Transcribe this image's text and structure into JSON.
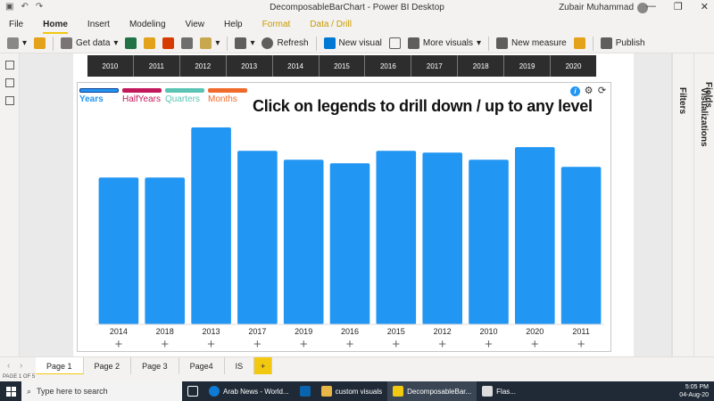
{
  "window": {
    "title": "DecomposableBarChart - Power BI Desktop",
    "user": "Zubair Muhammad",
    "minimize": "—",
    "maximize": "❐",
    "close": "✕"
  },
  "menu": [
    "File",
    "Home",
    "Insert",
    "Modeling",
    "View",
    "Help",
    "Format",
    "Data / Drill"
  ],
  "ribbon": {
    "get_data": "Get data",
    "refresh": "Refresh",
    "new_visual": "New visual",
    "more_visuals": "More visuals",
    "new_measure": "New measure",
    "publish": "Publish"
  },
  "panes": {
    "filters": "Filters",
    "visualizations": "Visualizations",
    "fields": "Fields"
  },
  "slicer_years": [
    "2010",
    "2011",
    "2012",
    "2013",
    "2014",
    "2015",
    "2016",
    "2017",
    "2018",
    "2019",
    "2020"
  ],
  "visual": {
    "headline": "Click on legends to drill down / up to any level",
    "legend": [
      {
        "label": "Years",
        "color": "#2196f3"
      },
      {
        "label": "HalfYears",
        "color": "#c2185b"
      },
      {
        "label": "Quarters",
        "color": "#5cc4b4"
      },
      {
        "label": "Months",
        "color": "#f06a2b"
      }
    ],
    "info_icon": "i"
  },
  "chart_data": {
    "type": "bar",
    "categories": [
      "2014",
      "2018",
      "2013",
      "2017",
      "2019",
      "2016",
      "2015",
      "2012",
      "2010",
      "2020",
      "2011"
    ],
    "values": [
      164,
      164,
      220,
      194,
      184,
      180,
      194,
      192,
      184,
      198,
      176
    ],
    "ylim": [
      0,
      230
    ],
    "bar_color": "#2196f3",
    "expand_symbol": "+"
  },
  "pages": [
    "Page 1",
    "Page 2",
    "Page 3",
    "Page4",
    "IS",
    "+"
  ],
  "status": "PAGE 1 OF 5",
  "taskbar": {
    "search_placeholder": "Type here to search",
    "apps": [
      "Arab News - World...",
      "custom visuals",
      "DecomposableBar...",
      "Flas..."
    ],
    "time": "5:05 PM",
    "date": "04-Aug-20"
  }
}
